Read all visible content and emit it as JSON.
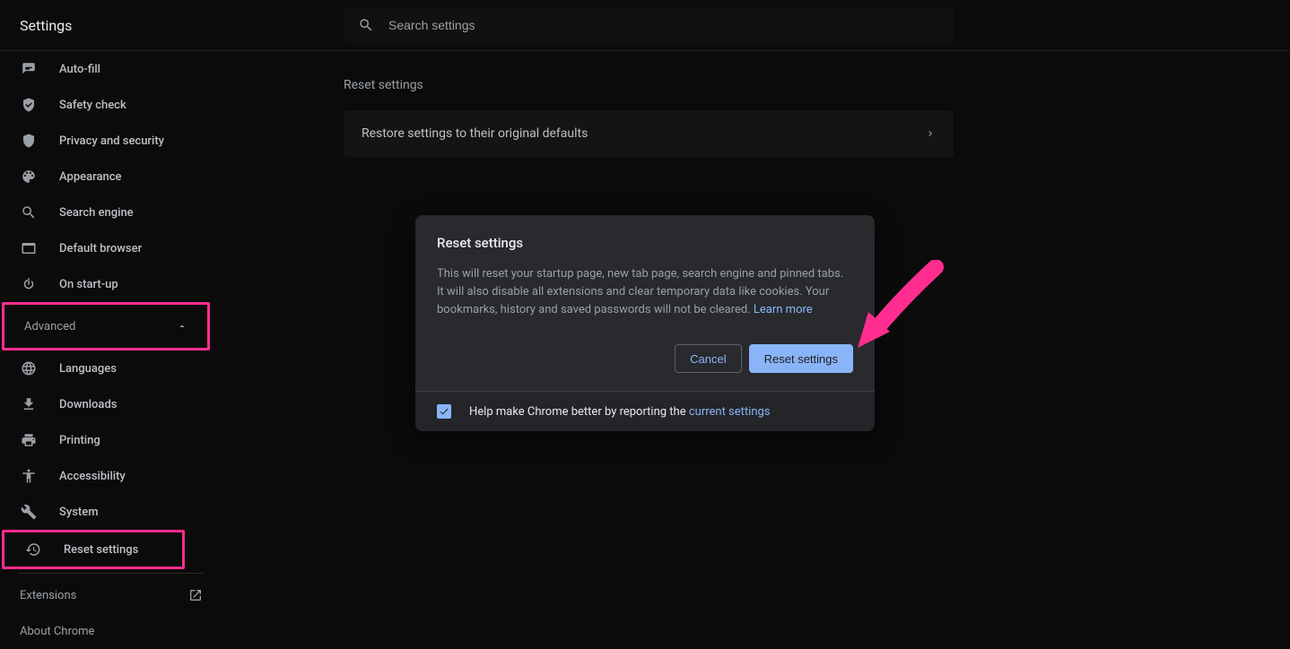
{
  "header": {
    "title": "Settings",
    "search_placeholder": "Search settings"
  },
  "sidebar": {
    "items": [
      {
        "label": "Auto-fill",
        "icon": "autofill-icon"
      },
      {
        "label": "Safety check",
        "icon": "shield-check-icon"
      },
      {
        "label": "Privacy and security",
        "icon": "shield-icon"
      },
      {
        "label": "Appearance",
        "icon": "palette-icon"
      },
      {
        "label": "Search engine",
        "icon": "search-icon"
      },
      {
        "label": "Default browser",
        "icon": "browser-icon"
      },
      {
        "label": "On start-up",
        "icon": "power-icon"
      }
    ],
    "advanced_label": "Advanced",
    "advanced_items": [
      {
        "label": "Languages",
        "icon": "globe-icon"
      },
      {
        "label": "Downloads",
        "icon": "download-icon"
      },
      {
        "label": "Printing",
        "icon": "printer-icon"
      },
      {
        "label": "Accessibility",
        "icon": "accessibility-icon"
      },
      {
        "label": "System",
        "icon": "wrench-icon"
      },
      {
        "label": "Reset settings",
        "icon": "restore-icon"
      }
    ],
    "extensions_label": "Extensions",
    "about_label": "About Chrome"
  },
  "main": {
    "section_title": "Reset settings",
    "row_label": "Restore settings to their original defaults"
  },
  "modal": {
    "title": "Reset settings",
    "body_text": "This will reset your startup page, new tab page, search engine and pinned tabs. It will also disable all extensions and clear temporary data like cookies. Your bookmarks, history and saved passwords will not be cleared. ",
    "learn_more": "Learn more",
    "cancel": "Cancel",
    "confirm": "Reset settings",
    "footer_text": "Help make Chrome better by reporting the ",
    "footer_link": "current settings",
    "checkbox_checked": true
  },
  "annotation": {
    "highlight_color": "#ff2d8f",
    "arrow_color": "#ff2d8f"
  }
}
